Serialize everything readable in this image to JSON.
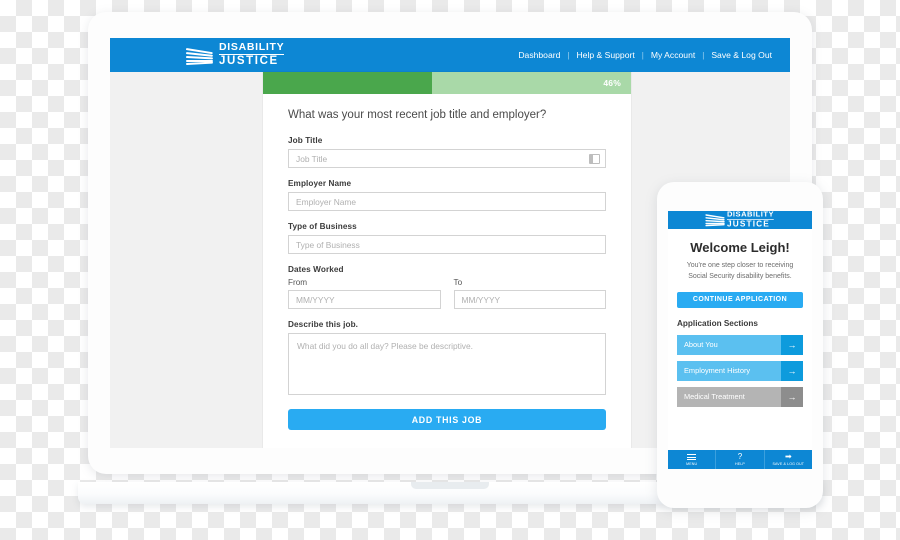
{
  "desktop": {
    "logo": {
      "line1": "DISABILITY",
      "line2": "JUSTICE"
    },
    "nav": [
      {
        "label": "Dashboard"
      },
      {
        "label": "Help & Support"
      },
      {
        "label": "My Account"
      },
      {
        "label": "Save & Log Out"
      }
    ],
    "nav_separator": "|",
    "progress": {
      "percent_label": "46%",
      "percent_value": 46
    },
    "question": "What was your most recent job title and employer?",
    "fields": {
      "job_title": {
        "label": "Job Title",
        "placeholder": "Job Title",
        "value": ""
      },
      "employer_name": {
        "label": "Employer Name",
        "placeholder": "Employer Name",
        "value": ""
      },
      "type_of_business": {
        "label": "Type of Business",
        "placeholder": "Type of Business",
        "value": ""
      },
      "dates_worked": {
        "label": "Dates Worked",
        "from_label": "From",
        "from_placeholder": "MM/YYYY",
        "to_label": "To",
        "to_placeholder": "MM/YYYY"
      },
      "describe": {
        "label": "Describe this job.",
        "placeholder": "What did you do all day? Please be descriptive."
      }
    },
    "submit_label": "ADD THIS JOB"
  },
  "mobile": {
    "logo": {
      "line1": "DISABILITY",
      "line2": "JUSTICE"
    },
    "welcome_title": "Welcome Leigh!",
    "welcome_sub": "You're one step closer to receiving Social Security disability benefits.",
    "continue_label": "CONTINUE APPLICATION",
    "sections_title": "Application Sections",
    "sections": [
      {
        "label": "About You",
        "state": "active",
        "arrow": "→"
      },
      {
        "label": "Employment History",
        "state": "active",
        "arrow": "→"
      },
      {
        "label": "Medical Treatment",
        "state": "disabled",
        "arrow": "→"
      }
    ],
    "tabs": [
      {
        "label": "MENU",
        "icon": "hamburger-icon"
      },
      {
        "label": "HELP",
        "icon": "question-icon",
        "glyph": "?"
      },
      {
        "label": "SAVE & LOG OUT",
        "icon": "logout-icon",
        "glyph": "➡"
      }
    ]
  },
  "colors": {
    "brand_blue": "#0d87d4",
    "action_blue": "#29abf2",
    "progress_green": "#4aa74c",
    "progress_track": "#a9d9a8",
    "section_blue": "#5bc0f0",
    "section_grey": "#b4b4b4",
    "page_grey": "#f1f1f1"
  }
}
